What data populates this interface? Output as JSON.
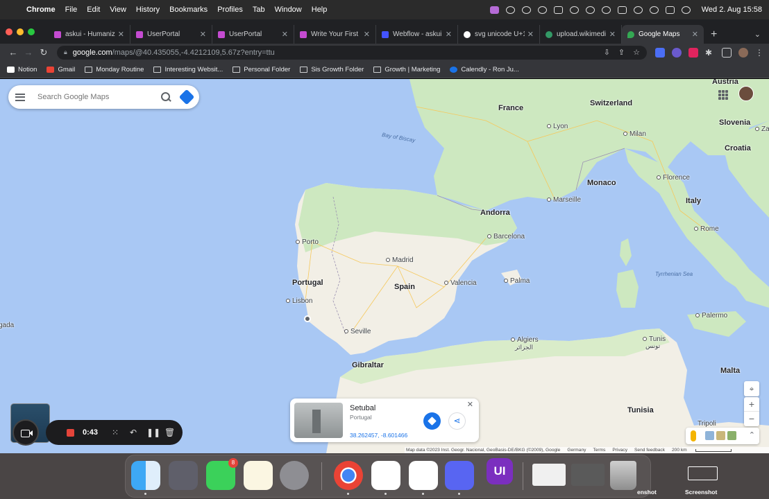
{
  "menubar": {
    "app_name": "Chrome",
    "menus": [
      "File",
      "Edit",
      "View",
      "History",
      "Bookmarks",
      "Profiles",
      "Tab",
      "Window",
      "Help"
    ],
    "datetime": "Wed 2. Aug  15:58"
  },
  "tabs": [
    {
      "label": "askui - Humaniz",
      "icon": "askui-icon",
      "color": "#c44bd1"
    },
    {
      "label": "UserPortal",
      "icon": "userportal-icon",
      "color": "#c44bd1"
    },
    {
      "label": "UserPortal",
      "icon": "userportal-icon",
      "color": "#c44bd1"
    },
    {
      "label": "Write Your First",
      "icon": "askui-icon",
      "color": "#c44bd1"
    },
    {
      "label": "Webflow - askui",
      "icon": "webflow-icon",
      "color": "#4353ff"
    },
    {
      "label": "svg unicode U+1",
      "icon": "google-icon",
      "color": "#ffffff"
    },
    {
      "label": "upload.wikimedi",
      "icon": "wikimedia-icon",
      "color": "#339966"
    },
    {
      "label": "Google Maps",
      "icon": "google-maps-icon",
      "color": "#34a853",
      "active": true
    }
  ],
  "address": {
    "host": "google.com",
    "path": "/maps/@40.435055,-4.4212109,5.67z?entry=ttu"
  },
  "bookmarks": [
    {
      "label": "Notion",
      "icon": "notion-icon"
    },
    {
      "label": "Gmail",
      "icon": "gmail-icon"
    },
    {
      "label": "Monday Routine",
      "icon": "folder-icon"
    },
    {
      "label": "Interesting Websit...",
      "icon": "folder-icon"
    },
    {
      "label": "Personal Folder",
      "icon": "folder-icon"
    },
    {
      "label": "Sis Growth Folder",
      "icon": "folder-icon"
    },
    {
      "label": "Growth | Marketing",
      "icon": "folder-icon"
    },
    {
      "label": "Calendly - Ron Ju...",
      "icon": "calendly-icon"
    }
  ],
  "search": {
    "placeholder": "Search Google Maps"
  },
  "map_labels": {
    "countries": {
      "austria": "Austria",
      "france": "France",
      "switzerland": "Switzerland",
      "slovenia": "Slovenia",
      "croatia": "Croatia",
      "monaco": "Monaco",
      "italy": "Italy",
      "andorra": "Andorra",
      "portugal": "Portugal",
      "spain": "Spain",
      "gibraltar": "Gibraltar",
      "malta": "Malta",
      "tunisia": "Tunisia"
    },
    "cities": {
      "lyon": "Lyon",
      "milan": "Milan",
      "marseille": "Marseille",
      "florence": "Florence",
      "rome": "Rome",
      "barcelona": "Barcelona",
      "porto": "Porto",
      "madrid": "Madrid",
      "valencia": "Valencia",
      "palma": "Palma",
      "lisbon": "Lisbon",
      "seville": "Seville",
      "algiers": "Algiers",
      "algiers_ar": "الجزائر",
      "tunis": "Tunis",
      "tunis_ar": "تونس",
      "palermo": "Palermo",
      "tripoli": "Tripoli",
      "zagreb_partial": "Za"
    },
    "seas": {
      "biscay": "Bay of Biscay",
      "tyrrhenian": "Tyrrhenian Sea"
    },
    "edge": {
      "left_partial": "gada"
    }
  },
  "place": {
    "name": "Setubal",
    "country": "Portugal",
    "coords": "38.262457, -8.601466"
  },
  "attribution": {
    "data": "Map data ©2023 Inst. Geogr. Nacional, GeoBasis-DE/BKG (©2009), Google",
    "country": "Germany",
    "terms": "Terms",
    "privacy": "Privacy",
    "feedback": "Send feedback",
    "scale": "200 km"
  },
  "recorder": {
    "time": "0:43"
  },
  "dock": {
    "messages_badge": "8",
    "ui_app_label": "UI",
    "desktop_labels": [
      "enshot",
      "Screenshot"
    ]
  },
  "colors": {
    "map_water": "#a9c8f4",
    "map_land": "#cde8c0",
    "map_land_dry": "#f2efe6",
    "accent": "#1a73e8"
  }
}
